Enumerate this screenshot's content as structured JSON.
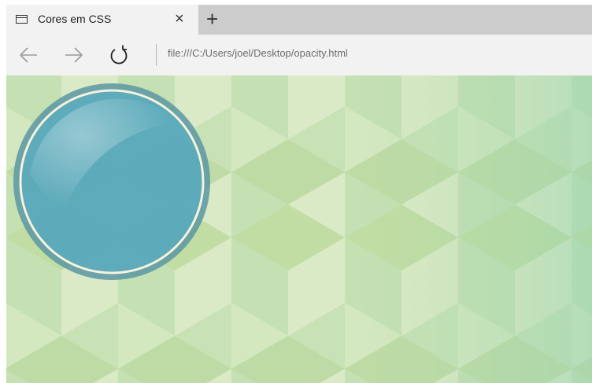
{
  "browser": {
    "tab": {
      "title": "Cores em CSS",
      "icon": "page-icon",
      "close_icon": "close-icon",
      "close_glyph": "×"
    },
    "new_tab_icon": "plus-icon",
    "new_tab_glyph": "+",
    "nav": {
      "back_icon": "back-arrow-icon",
      "forward_icon": "forward-arrow-icon",
      "refresh_icon": "refresh-icon"
    },
    "address": "file:///C:/Users/joel/Desktop/opacity.html"
  },
  "page": {
    "background_pattern": "isometric-cube-pattern",
    "colors": {
      "light": "#dcebc5",
      "mid": "#c3dfb2",
      "dark": "#a8d5a6",
      "circle_fill": "#5aaec2",
      "circle_ring": "#5b97a3",
      "circle_inner_ring": "#f3f4df"
    },
    "circle": {
      "description_icon": "translucent-circle"
    }
  }
}
